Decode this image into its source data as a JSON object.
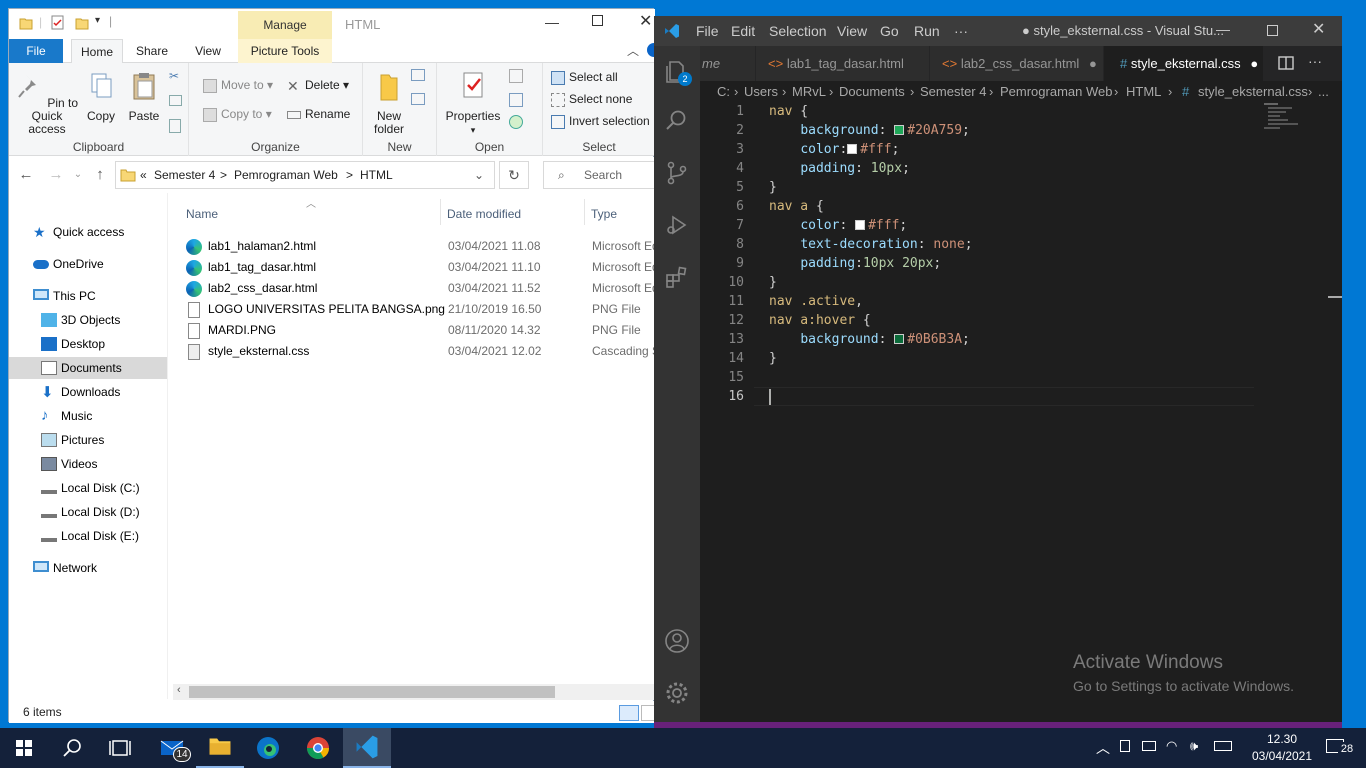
{
  "explorer": {
    "manage_label": "Manage",
    "title": "HTML",
    "tabs": {
      "file": "File",
      "home": "Home",
      "share": "Share",
      "view": "View",
      "picture_tools": "Picture Tools"
    },
    "ribbon": {
      "pin": "Pin to Quick access",
      "copy": "Copy",
      "paste": "Paste",
      "clipboard": "Clipboard",
      "move_to": "Move to",
      "copy_to": "Copy to",
      "delete": "Delete",
      "rename": "Rename",
      "organize": "Organize",
      "new_folder": "New folder",
      "new": "New",
      "properties": "Properties",
      "open": "Open",
      "select_all": "Select all",
      "select_none": "Select none",
      "invert_selection": "Invert selection",
      "select": "Select"
    },
    "address": {
      "overflow": "«",
      "crumbs": [
        "Semester 4",
        "Pemrograman Web",
        "HTML"
      ],
      "search_placeholder": "Search HTML"
    },
    "nav": [
      {
        "label": "Quick access",
        "icon": "star-icon"
      },
      {
        "label": "OneDrive",
        "icon": "cloud-icon"
      },
      {
        "label": "This PC",
        "icon": "computer-icon"
      },
      {
        "label": "3D Objects",
        "icon": "cube-icon"
      },
      {
        "label": "Desktop",
        "icon": "desktop-icon"
      },
      {
        "label": "Documents",
        "icon": "documents-icon"
      },
      {
        "label": "Downloads",
        "icon": "download-icon"
      },
      {
        "label": "Music",
        "icon": "music-icon"
      },
      {
        "label": "Pictures",
        "icon": "pictures-icon"
      },
      {
        "label": "Videos",
        "icon": "videos-icon"
      },
      {
        "label": "Local Disk (C:)",
        "icon": "drive-icon"
      },
      {
        "label": "Local Disk (D:)",
        "icon": "drive-icon"
      },
      {
        "label": "Local Disk (E:)",
        "icon": "drive-icon"
      },
      {
        "label": "Network",
        "icon": "network-icon"
      }
    ],
    "columns": {
      "name": "Name",
      "date": "Date modified",
      "type": "Type"
    },
    "files": [
      {
        "name": "lab1_halaman2.html",
        "date": "03/04/2021 11.08",
        "type": "Microsoft Ed",
        "icon": "edge-icon"
      },
      {
        "name": "lab1_tag_dasar.html",
        "date": "03/04/2021 11.10",
        "type": "Microsoft Ed",
        "icon": "edge-icon"
      },
      {
        "name": "lab2_css_dasar.html",
        "date": "03/04/2021 11.52",
        "type": "Microsoft Ed",
        "icon": "edge-icon"
      },
      {
        "name": "LOGO UNIVERSITAS PELITA BANGSA.png",
        "date": "21/10/2019 16.50",
        "type": "PNG File",
        "icon": "image-file-icon"
      },
      {
        "name": "MARDI.PNG",
        "date": "08/11/2020 14.32",
        "type": "PNG File",
        "icon": "image-file-icon"
      },
      {
        "name": "style_eksternal.css",
        "date": "03/04/2021 12.02",
        "type": "Cascading S",
        "icon": "css-file-icon"
      }
    ],
    "status": "6 items"
  },
  "vscode": {
    "menu": [
      "File",
      "Edit",
      "Selection",
      "View",
      "Go",
      "Run",
      "···"
    ],
    "title": "● style_eksternal.css - Visual Stu...",
    "tabs": [
      {
        "label": "me",
        "dirty": ""
      },
      {
        "label": "lab1_tag_dasar.html",
        "dirty": ""
      },
      {
        "label": "lab2_css_dasar.html",
        "dirty": "●"
      },
      {
        "label": "style_eksternal.css",
        "dirty": "●"
      }
    ],
    "breadcrumb": [
      "C:",
      "Users",
      "MRvL",
      "Documents",
      "Semester 4",
      "Pemrograman Web",
      "HTML",
      "style_eksternal.css",
      "..."
    ],
    "badge": "2",
    "line_numbers": [
      "1",
      "2",
      "3",
      "4",
      "5",
      "6",
      "7",
      "8",
      "9",
      "10",
      "11",
      "12",
      "13",
      "14",
      "15",
      "16"
    ],
    "code": {
      "l1_sel": "nav",
      "l1_brace": " {",
      "l2_prop": "background",
      "l2_val": "#20A759",
      "l2_color": "#20A759",
      "l3_prop": "color",
      "l3_val": "#fff",
      "l3_color": "#ffffff",
      "l4_prop": "padding",
      "l4_val": "10px",
      "l5": "}",
      "l6_sel": "nav a",
      "l6_brace": " {",
      "l7_prop": "color",
      "l7_val": "#fff",
      "l7_color": "#ffffff",
      "l8_prop": "text-decoration",
      "l8_val": "none",
      "l9_prop": "padding",
      "l9_val": "10px 20px",
      "l10": "}",
      "l11_sel": "nav .active",
      "l11_punct": ",",
      "l12_sel": "nav a:hover",
      "l12_brace": " {",
      "l13_prop": "background",
      "l13_val": "#0B6B3A",
      "l13_color": "#0B6B3A",
      "l14": "}"
    },
    "activate_title": "Activate Windows",
    "activate_sub": "Go to Settings to activate Windows."
  },
  "taskbar": {
    "mail_badge": "14",
    "time": "12.30",
    "date": "03/04/2021",
    "notif_count": "28"
  }
}
